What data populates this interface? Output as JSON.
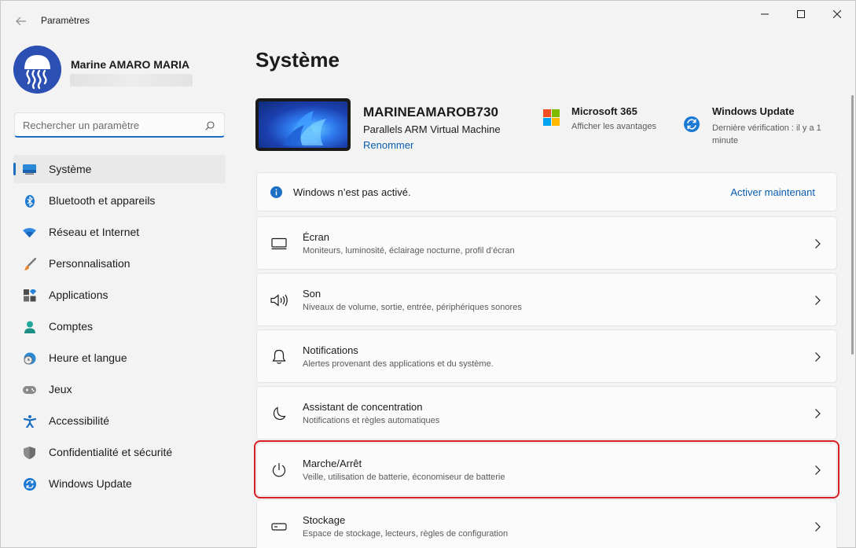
{
  "titlebar": {
    "app_title": "Paramètres",
    "icons": {
      "back": "back-arrow-icon",
      "minimize": "minimize-icon",
      "maximize": "maximize-icon",
      "close": "close-icon"
    }
  },
  "profile": {
    "name": "Marine AMARO MARIA"
  },
  "search": {
    "placeholder": "Rechercher un paramètre",
    "value": ""
  },
  "nav": {
    "items": [
      {
        "label": "Système",
        "icon": "display-icon",
        "active": true
      },
      {
        "label": "Bluetooth et appareils",
        "icon": "bluetooth-icon",
        "active": false
      },
      {
        "label": "Réseau et Internet",
        "icon": "wifi-icon",
        "active": false
      },
      {
        "label": "Personnalisation",
        "icon": "brush-icon",
        "active": false
      },
      {
        "label": "Applications",
        "icon": "apps-icon",
        "active": false
      },
      {
        "label": "Comptes",
        "icon": "person-icon",
        "active": false
      },
      {
        "label": "Heure et langue",
        "icon": "globe-clock-icon",
        "active": false
      },
      {
        "label": "Jeux",
        "icon": "gamepad-icon",
        "active": false
      },
      {
        "label": "Accessibilité",
        "icon": "accessibility-icon",
        "active": false
      },
      {
        "label": "Confidentialité et sécurité",
        "icon": "shield-icon",
        "active": false
      },
      {
        "label": "Windows Update",
        "icon": "update-icon",
        "active": false
      }
    ]
  },
  "main": {
    "page_title": "Système",
    "device": {
      "name": "MARINEAMAROB730",
      "model": "Parallels ARM Virtual Machine",
      "rename": "Renommer"
    },
    "m365": {
      "title": "Microsoft 365",
      "sub": "Afficher les avantages"
    },
    "windows_update": {
      "title": "Windows Update",
      "sub": "Dernière vérification : il y a 1 minute"
    },
    "banner": {
      "text": "Windows n’est pas activé.",
      "action": "Activer maintenant"
    },
    "cards": [
      {
        "title": "Écran",
        "sub": "Moniteurs, luminosité, éclairage nocturne, profil d’écran",
        "icon": "monitor-icon"
      },
      {
        "title": "Son",
        "sub": "Niveaux de volume, sortie, entrée, périphériques sonores",
        "icon": "speaker-icon"
      },
      {
        "title": "Notifications",
        "sub": "Alertes provenant des applications et du système.",
        "icon": "bell-icon"
      },
      {
        "title": "Assistant de concentration",
        "sub": "Notifications et règles automatiques",
        "icon": "moon-icon"
      },
      {
        "title": "Marche/Arrêt",
        "sub": "Veille, utilisation de batterie, économiseur de batterie",
        "icon": "power-icon",
        "highlighted": true
      },
      {
        "title": "Stockage",
        "sub": "Espace de stockage, lecteurs, règles de configuration",
        "icon": "storage-icon"
      }
    ]
  },
  "colors": {
    "accent": "#1d6fc4",
    "link": "#0b5cad",
    "highlight_border": "#d81f26",
    "background": "#f3f3f3",
    "card": "#fbfbfb"
  }
}
